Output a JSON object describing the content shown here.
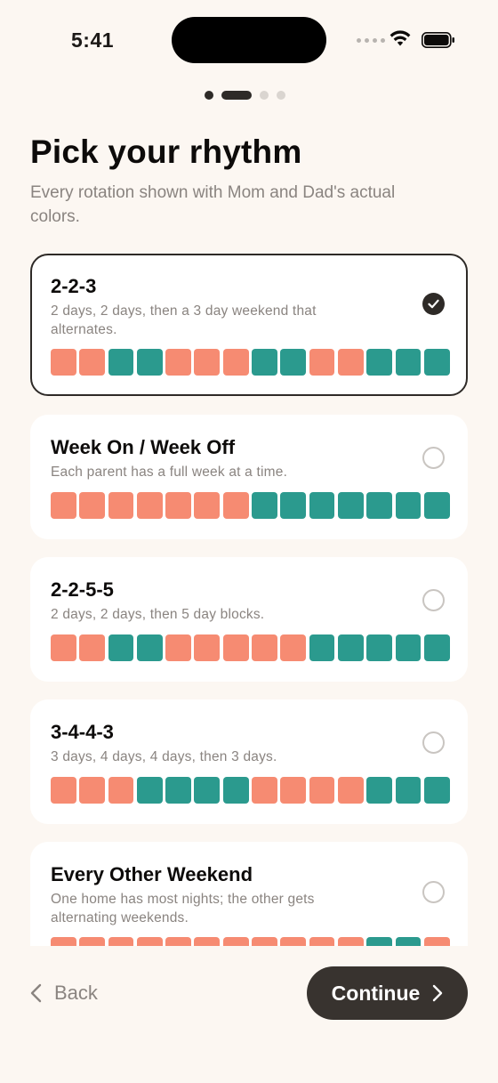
{
  "status": {
    "time": "5:41"
  },
  "header": {
    "title": "Pick your rhythm",
    "subtitle": "Every rotation shown with Mom and Dad's actual colors."
  },
  "colors": {
    "mom": "#f68b72",
    "dad": "#2b9a8e",
    "accent": "#2e2a27",
    "background": "#fcf7f2"
  },
  "pager": {
    "total": 4,
    "current": 2
  },
  "schedules": [
    {
      "name": "2-2-3",
      "description": "2 days, 2 days, then a 3 day weekend that alternates.",
      "selected": true,
      "days": [
        "mom",
        "mom",
        "dad",
        "dad",
        "mom",
        "mom",
        "mom",
        "dad",
        "dad",
        "mom",
        "mom",
        "dad",
        "dad",
        "dad"
      ]
    },
    {
      "name": "Week On / Week Off",
      "description": "Each parent has a full week at a time.",
      "selected": false,
      "days": [
        "mom",
        "mom",
        "mom",
        "mom",
        "mom",
        "mom",
        "mom",
        "dad",
        "dad",
        "dad",
        "dad",
        "dad",
        "dad",
        "dad"
      ]
    },
    {
      "name": "2-2-5-5",
      "description": "2 days, 2 days, then 5 day blocks.",
      "selected": false,
      "days": [
        "mom",
        "mom",
        "dad",
        "dad",
        "mom",
        "mom",
        "mom",
        "mom",
        "mom",
        "dad",
        "dad",
        "dad",
        "dad",
        "dad"
      ]
    },
    {
      "name": "3-4-4-3",
      "description": "3 days, 4 days, 4 days, then 3 days.",
      "selected": false,
      "days": [
        "mom",
        "mom",
        "mom",
        "dad",
        "dad",
        "dad",
        "dad",
        "mom",
        "mom",
        "mom",
        "mom",
        "dad",
        "dad",
        "dad"
      ]
    },
    {
      "name": "Every Other Weekend",
      "description": "One home has most nights; the other gets alternating weekends.",
      "selected": false,
      "days": [
        "mom",
        "mom",
        "mom",
        "mom",
        "mom",
        "mom",
        "mom",
        "mom",
        "mom",
        "mom",
        "mom",
        "dad",
        "dad",
        "mom"
      ]
    }
  ],
  "footer": {
    "back_label": "Back",
    "continue_label": "Continue"
  }
}
